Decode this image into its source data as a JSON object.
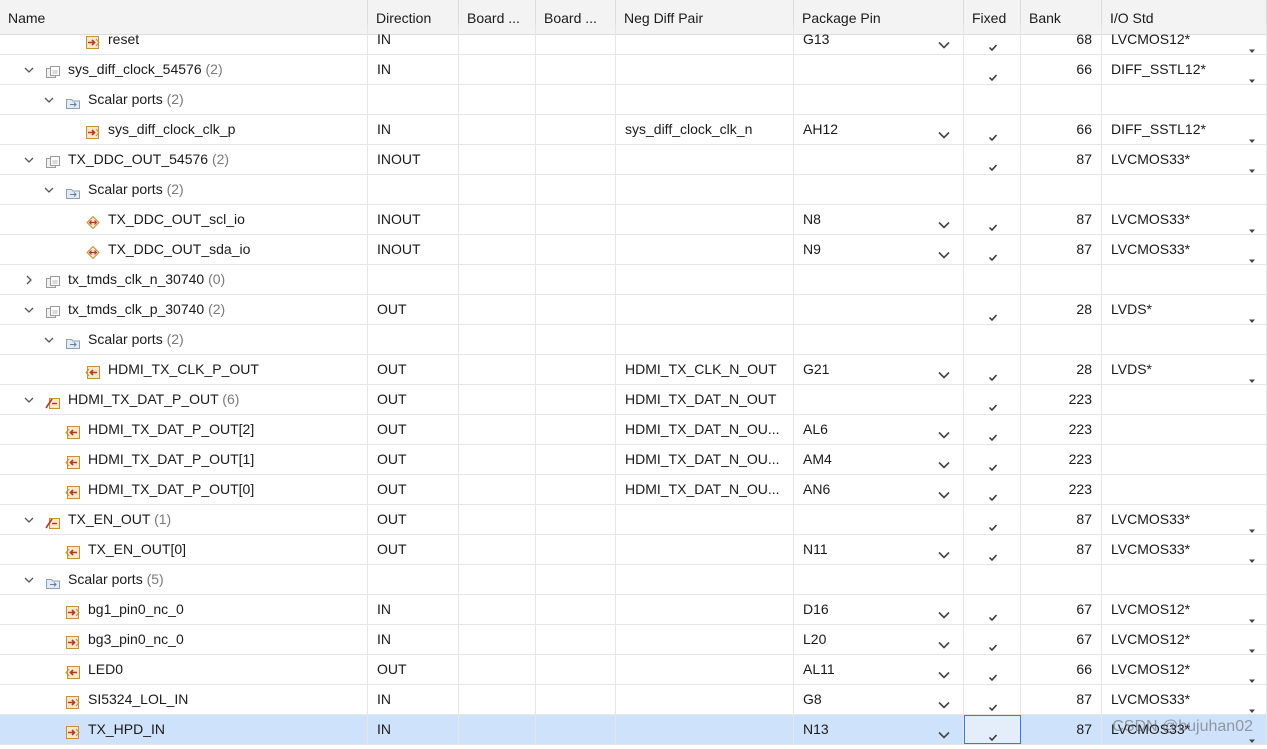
{
  "columns": [
    "Name",
    "Direction",
    "Board ...",
    "Board ...",
    "Neg Diff Pair",
    "Package Pin",
    "Fixed",
    "Bank",
    "I/O Std"
  ],
  "rows": [
    {
      "level": 3,
      "expander": "none",
      "icon": "port-in-icon",
      "name": "reset",
      "count": "",
      "direction": "IN",
      "neg_diff_pair": "",
      "package_pin": "G13",
      "pin_dropdown": true,
      "fixed": true,
      "bank": "68",
      "io_std": "LVCMOS12*",
      "iostd_dropdown": true,
      "selected": false
    },
    {
      "level": 1,
      "expander": "expanded",
      "icon": "interface-icon",
      "name": "sys_diff_clock_54576",
      "count": "(2)",
      "direction": "IN",
      "neg_diff_pair": "",
      "package_pin": "",
      "pin_dropdown": false,
      "fixed": true,
      "bank": "66",
      "io_std": "DIFF_SSTL12*",
      "iostd_dropdown": true,
      "selected": false
    },
    {
      "level": 2,
      "expander": "expanded",
      "icon": "folder-icon",
      "name": "Scalar ports",
      "count": "(2)",
      "direction": "",
      "neg_diff_pair": "",
      "package_pin": "",
      "pin_dropdown": false,
      "fixed": false,
      "bank": "",
      "io_std": "",
      "iostd_dropdown": false,
      "selected": false
    },
    {
      "level": 3,
      "expander": "none",
      "icon": "port-in-icon",
      "name": "sys_diff_clock_clk_p",
      "count": "",
      "direction": "IN",
      "neg_diff_pair": "sys_diff_clock_clk_n",
      "package_pin": "AH12",
      "pin_dropdown": true,
      "fixed": true,
      "bank": "66",
      "io_std": "DIFF_SSTL12*",
      "iostd_dropdown": true,
      "selected": false
    },
    {
      "level": 1,
      "expander": "expanded",
      "icon": "interface-icon",
      "name": "TX_DDC_OUT_54576",
      "count": "(2)",
      "direction": "INOUT",
      "neg_diff_pair": "",
      "package_pin": "",
      "pin_dropdown": false,
      "fixed": true,
      "bank": "87",
      "io_std": "LVCMOS33*",
      "iostd_dropdown": true,
      "selected": false
    },
    {
      "level": 2,
      "expander": "expanded",
      "icon": "folder-icon",
      "name": "Scalar ports",
      "count": "(2)",
      "direction": "",
      "neg_diff_pair": "",
      "package_pin": "",
      "pin_dropdown": false,
      "fixed": false,
      "bank": "",
      "io_std": "",
      "iostd_dropdown": false,
      "selected": false
    },
    {
      "level": 3,
      "expander": "none",
      "icon": "port-inout-icon",
      "name": "TX_DDC_OUT_scl_io",
      "count": "",
      "direction": "INOUT",
      "neg_diff_pair": "",
      "package_pin": "N8",
      "pin_dropdown": true,
      "fixed": true,
      "bank": "87",
      "io_std": "LVCMOS33*",
      "iostd_dropdown": true,
      "selected": false
    },
    {
      "level": 3,
      "expander": "none",
      "icon": "port-inout-icon",
      "name": "TX_DDC_OUT_sda_io",
      "count": "",
      "direction": "INOUT",
      "neg_diff_pair": "",
      "package_pin": "N9",
      "pin_dropdown": true,
      "fixed": true,
      "bank": "87",
      "io_std": "LVCMOS33*",
      "iostd_dropdown": true,
      "selected": false
    },
    {
      "level": 1,
      "expander": "collapsed",
      "icon": "interface-icon",
      "name": "tx_tmds_clk_n_30740",
      "count": "(0)",
      "direction": "",
      "neg_diff_pair": "",
      "package_pin": "",
      "pin_dropdown": false,
      "fixed": false,
      "bank": "",
      "io_std": "",
      "iostd_dropdown": false,
      "selected": false
    },
    {
      "level": 1,
      "expander": "expanded",
      "icon": "interface-icon",
      "name": "tx_tmds_clk_p_30740",
      "count": "(2)",
      "direction": "OUT",
      "neg_diff_pair": "",
      "package_pin": "",
      "pin_dropdown": false,
      "fixed": true,
      "bank": "28",
      "io_std": "LVDS*",
      "iostd_dropdown": true,
      "selected": false
    },
    {
      "level": 2,
      "expander": "expanded",
      "icon": "folder-icon",
      "name": "Scalar ports",
      "count": "(2)",
      "direction": "",
      "neg_diff_pair": "",
      "package_pin": "",
      "pin_dropdown": false,
      "fixed": false,
      "bank": "",
      "io_std": "",
      "iostd_dropdown": false,
      "selected": false
    },
    {
      "level": 3,
      "expander": "none",
      "icon": "port-out-icon",
      "name": "HDMI_TX_CLK_P_OUT",
      "count": "",
      "direction": "OUT",
      "neg_diff_pair": "HDMI_TX_CLK_N_OUT",
      "package_pin": "G21",
      "pin_dropdown": true,
      "fixed": true,
      "bank": "28",
      "io_std": "LVDS*",
      "iostd_dropdown": true,
      "selected": false
    },
    {
      "level": 1,
      "expander": "expanded",
      "icon": "bus-out-icon",
      "name": "HDMI_TX_DAT_P_OUT",
      "count": "(6)",
      "direction": "OUT",
      "neg_diff_pair": "HDMI_TX_DAT_N_OUT",
      "package_pin": "",
      "pin_dropdown": false,
      "fixed": true,
      "bank": "223",
      "io_std": "",
      "iostd_dropdown": false,
      "selected": false
    },
    {
      "level": 2,
      "expander": "none",
      "icon": "port-out-icon",
      "name": "HDMI_TX_DAT_P_OUT[2]",
      "count": "",
      "direction": "OUT",
      "neg_diff_pair": "HDMI_TX_DAT_N_OU...",
      "package_pin": "AL6",
      "pin_dropdown": true,
      "fixed": true,
      "bank": "223",
      "io_std": "",
      "iostd_dropdown": false,
      "selected": false
    },
    {
      "level": 2,
      "expander": "none",
      "icon": "port-out-icon",
      "name": "HDMI_TX_DAT_P_OUT[1]",
      "count": "",
      "direction": "OUT",
      "neg_diff_pair": "HDMI_TX_DAT_N_OU...",
      "package_pin": "AM4",
      "pin_dropdown": true,
      "fixed": true,
      "bank": "223",
      "io_std": "",
      "iostd_dropdown": false,
      "selected": false
    },
    {
      "level": 2,
      "expander": "none",
      "icon": "port-out-icon",
      "name": "HDMI_TX_DAT_P_OUT[0]",
      "count": "",
      "direction": "OUT",
      "neg_diff_pair": "HDMI_TX_DAT_N_OU...",
      "package_pin": "AN6",
      "pin_dropdown": true,
      "fixed": true,
      "bank": "223",
      "io_std": "",
      "iostd_dropdown": false,
      "selected": false
    },
    {
      "level": 1,
      "expander": "expanded",
      "icon": "bus-out-icon",
      "name": "TX_EN_OUT",
      "count": "(1)",
      "direction": "OUT",
      "neg_diff_pair": "",
      "package_pin": "",
      "pin_dropdown": false,
      "fixed": true,
      "bank": "87",
      "io_std": "LVCMOS33*",
      "iostd_dropdown": true,
      "selected": false
    },
    {
      "level": 2,
      "expander": "none",
      "icon": "port-out-icon",
      "name": "TX_EN_OUT[0]",
      "count": "",
      "direction": "OUT",
      "neg_diff_pair": "",
      "package_pin": "N11",
      "pin_dropdown": true,
      "fixed": true,
      "bank": "87",
      "io_std": "LVCMOS33*",
      "iostd_dropdown": true,
      "selected": false
    },
    {
      "level": 1,
      "expander": "expanded",
      "icon": "folder-icon",
      "name": "Scalar ports",
      "count": "(5)",
      "direction": "",
      "neg_diff_pair": "",
      "package_pin": "",
      "pin_dropdown": false,
      "fixed": false,
      "bank": "",
      "io_std": "",
      "iostd_dropdown": false,
      "selected": false
    },
    {
      "level": 2,
      "expander": "none",
      "icon": "port-in-icon",
      "name": "bg1_pin0_nc_0",
      "count": "",
      "direction": "IN",
      "neg_diff_pair": "",
      "package_pin": "D16",
      "pin_dropdown": true,
      "fixed": true,
      "bank": "67",
      "io_std": "LVCMOS12*",
      "iostd_dropdown": true,
      "selected": false
    },
    {
      "level": 2,
      "expander": "none",
      "icon": "port-in-icon",
      "name": "bg3_pin0_nc_0",
      "count": "",
      "direction": "IN",
      "neg_diff_pair": "",
      "package_pin": "L20",
      "pin_dropdown": true,
      "fixed": true,
      "bank": "67",
      "io_std": "LVCMOS12*",
      "iostd_dropdown": true,
      "selected": false
    },
    {
      "level": 2,
      "expander": "none",
      "icon": "port-out-icon",
      "name": "LED0",
      "count": "",
      "direction": "OUT",
      "neg_diff_pair": "",
      "package_pin": "AL11",
      "pin_dropdown": true,
      "fixed": true,
      "bank": "66",
      "io_std": "LVCMOS12*",
      "iostd_dropdown": true,
      "selected": false
    },
    {
      "level": 2,
      "expander": "none",
      "icon": "port-in-icon",
      "name": "SI5324_LOL_IN",
      "count": "",
      "direction": "IN",
      "neg_diff_pair": "",
      "package_pin": "G8",
      "pin_dropdown": true,
      "fixed": true,
      "bank": "87",
      "io_std": "LVCMOS33*",
      "iostd_dropdown": true,
      "selected": false
    },
    {
      "level": 2,
      "expander": "none",
      "icon": "port-in-icon",
      "name": "TX_HPD_IN",
      "count": "",
      "direction": "IN",
      "neg_diff_pair": "",
      "package_pin": "N13",
      "pin_dropdown": true,
      "fixed": true,
      "bank": "87",
      "io_std": "LVCMOS33*",
      "iostd_dropdown": true,
      "selected": true
    }
  ],
  "watermark": "CSDN @bujuhan02",
  "colors": {
    "selected_row": "#cfe2fb",
    "header_bg": "#f3f3f3",
    "icon_gold": "#d8a03a",
    "count_gray": "#7a7a7a"
  }
}
